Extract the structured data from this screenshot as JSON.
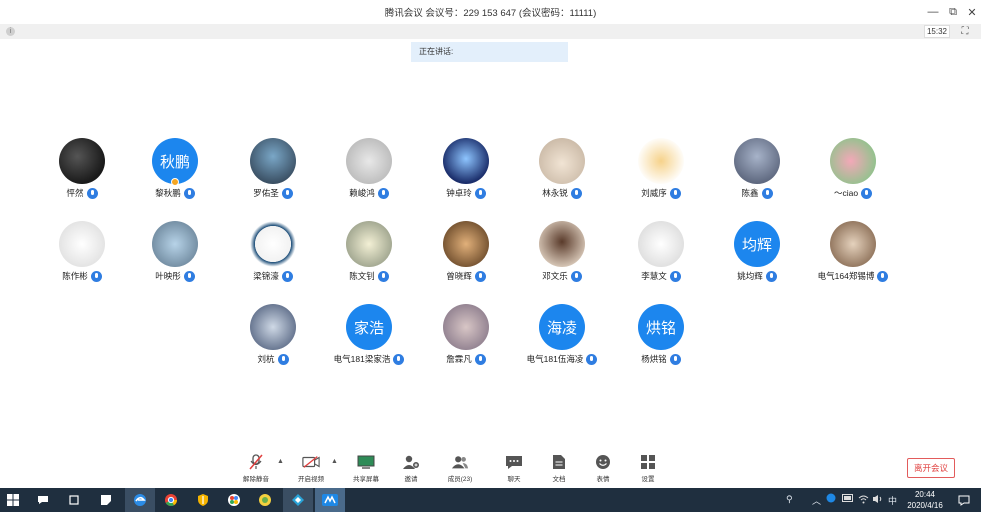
{
  "titlebar": {
    "title": "腾讯会议  会议号：229 153 647  (会议密码：11111)",
    "minimize_icon": "—",
    "restore_icon": "⧉",
    "close_icon": "✕"
  },
  "infobar": {
    "time": "15:32",
    "fullscreen_icon": "⛶"
  },
  "speaking": {
    "label": "正在讲话:"
  },
  "participants": [
    {
      "name": "怦然",
      "avatar_text": ""
    },
    {
      "name": "黎秋鹏",
      "avatar_text": "秋鹏"
    },
    {
      "name": "罗佑圣",
      "avatar_text": ""
    },
    {
      "name": "赖峻鸿",
      "avatar_text": ""
    },
    {
      "name": "钟卓玲",
      "avatar_text": ""
    },
    {
      "name": "林永锐",
      "avatar_text": ""
    },
    {
      "name": "刘威序",
      "avatar_text": ""
    },
    {
      "name": "陈鑫",
      "avatar_text": ""
    },
    {
      "name": "～ciao",
      "avatar_text": ""
    },
    {
      "name": "陈作彬",
      "avatar_text": ""
    },
    {
      "name": "叶映彤",
      "avatar_text": ""
    },
    {
      "name": "梁锦濠",
      "avatar_text": ""
    },
    {
      "name": "陈文钊",
      "avatar_text": ""
    },
    {
      "name": "曾晓辉",
      "avatar_text": ""
    },
    {
      "name": "邓文乐",
      "avatar_text": ""
    },
    {
      "name": "李慧文",
      "avatar_text": ""
    },
    {
      "name": "姚均辉",
      "avatar_text": "均辉"
    },
    {
      "name": "电气164郑锡博",
      "avatar_text": ""
    },
    {
      "name": "刘杭",
      "avatar_text": ""
    },
    {
      "name": "电气181梁家浩",
      "avatar_text": "家浩"
    },
    {
      "name": "詹霖凡",
      "avatar_text": ""
    },
    {
      "name": "电气181伍海凌",
      "avatar_text": "海凌"
    },
    {
      "name": "杨烘铭",
      "avatar_text": "烘铭"
    }
  ],
  "toolbar": {
    "unmute": "解除静音",
    "video": "开启视频",
    "share": "共享屏幕",
    "invite": "邀请",
    "members": "成员(23)",
    "chat": "聊天",
    "docs": "文档",
    "emoji": "表情",
    "settings": "设置",
    "leave": "离开会议"
  },
  "taskbar": {
    "time": "20:44",
    "date": "2020/4/16",
    "ime": "中"
  }
}
